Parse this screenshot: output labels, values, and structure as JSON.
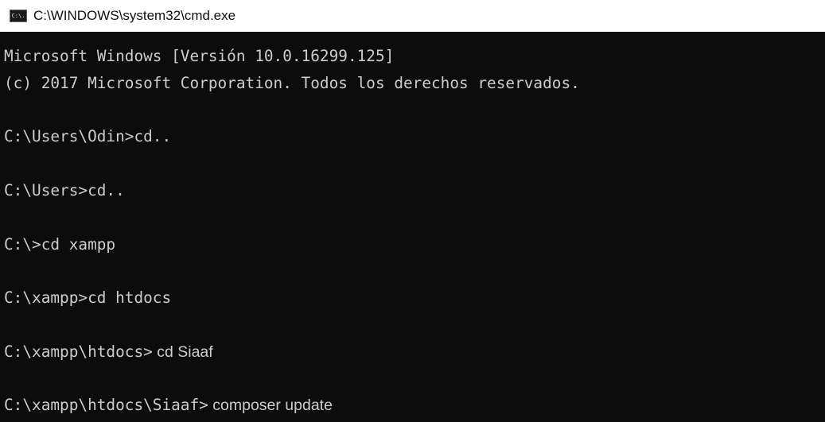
{
  "window": {
    "title": "C:\\WINDOWS\\system32\\cmd.exe",
    "icon": "cmd-icon",
    "icon_text": "C:\\."
  },
  "console": {
    "banner": [
      "Microsoft Windows [Versión 10.0.16299.125]",
      "(c) 2017 Microsoft Corporation. Todos los derechos reservados."
    ],
    "entries": [
      {
        "prompt": "C:\\Users\\Odin>",
        "command": "cd.."
      },
      {
        "prompt": "C:\\Users>",
        "command": "cd.."
      },
      {
        "prompt": "C:\\>",
        "command": "cd xampp"
      },
      {
        "prompt": "C:\\xampp>",
        "command": "cd htdocs"
      },
      {
        "prompt": "C:\\xampp\\htdocs>",
        "command": " cd Siaaf"
      },
      {
        "prompt": "C:\\xampp\\htdocs\\Siaaf>",
        "command": " composer update"
      }
    ],
    "colors": {
      "background": "#0c0c0c",
      "text": "#cccccc"
    }
  }
}
